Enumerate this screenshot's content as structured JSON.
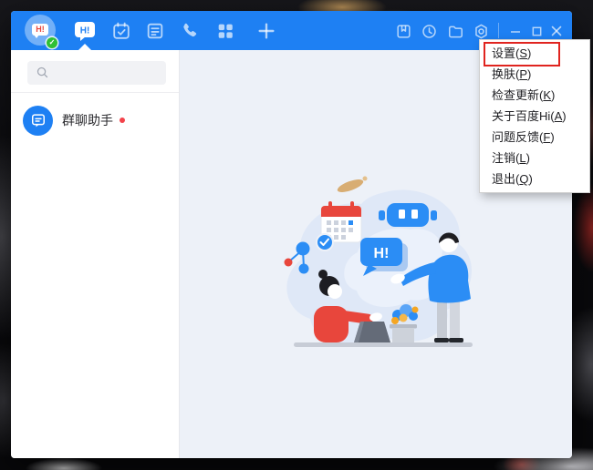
{
  "titlebar": {
    "avatar": {
      "logo_text": "H!",
      "status_check": "✓"
    },
    "chat_tab_label": "H!",
    "nav_icons": [
      "chat",
      "calendar",
      "news",
      "phone",
      "apps",
      "add"
    ],
    "tool_icons": [
      "favorites",
      "history",
      "folder",
      "settings"
    ],
    "window_controls": [
      "minimize",
      "maximize",
      "close"
    ]
  },
  "sidebar": {
    "search": {
      "placeholder": ""
    },
    "items": [
      {
        "label": "群聊助手",
        "unread": true
      }
    ]
  },
  "main": {
    "illustration": {
      "bubble_text": "H!"
    }
  },
  "menu": {
    "items": [
      {
        "label": "设置",
        "mnemonic": "S",
        "highlighted": true
      },
      {
        "label": "换肤",
        "mnemonic": "P",
        "highlighted": false
      },
      {
        "label": "检查更新",
        "mnemonic": "K",
        "highlighted": false
      },
      {
        "label": "关于百度Hi",
        "mnemonic": "A",
        "highlighted": false
      },
      {
        "label": "问题反馈",
        "mnemonic": "F",
        "highlighted": false
      },
      {
        "label": "注销",
        "mnemonic": "L",
        "highlighted": false
      },
      {
        "label": "退出",
        "mnemonic": "Q",
        "highlighted": false
      }
    ]
  },
  "colors": {
    "titlebar_blue": "#1e80f3",
    "accent_blue": "#2b8df5",
    "main_bg": "#edf1f8",
    "unread_red": "#f3434a",
    "online_green": "#2fc035",
    "annotation_red": "#e0241f"
  }
}
